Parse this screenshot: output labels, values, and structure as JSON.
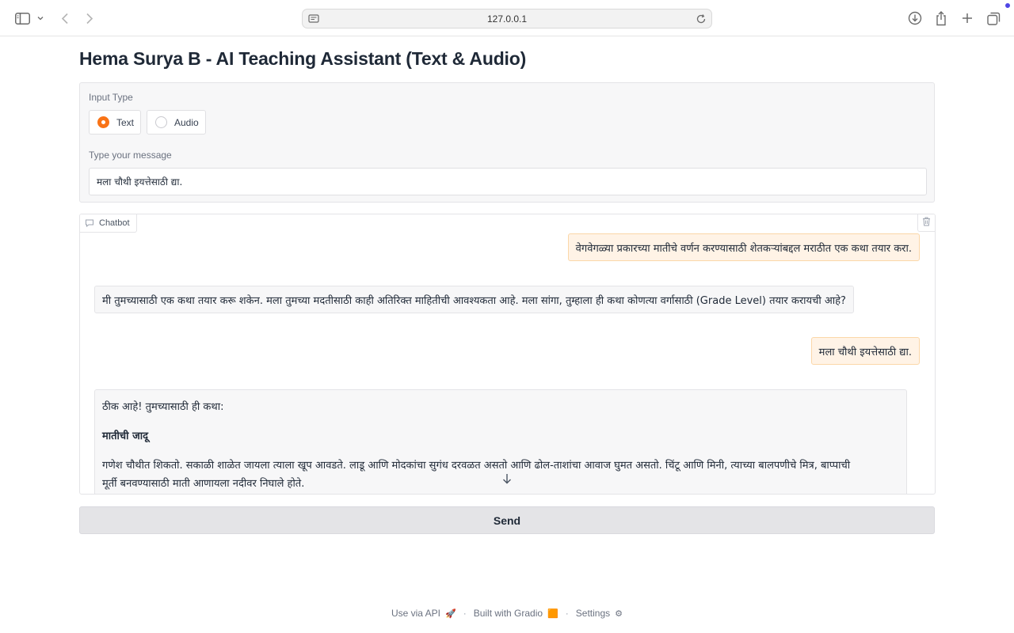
{
  "browser": {
    "url": "127.0.0.1",
    "icons": [
      "sidebar-icon",
      "chevron-down-icon",
      "back-arrow-icon",
      "forward-arrow-icon",
      "site-settings-icon",
      "reload-icon",
      "download-icon",
      "share-icon",
      "new-tab-plus-icon",
      "tabs-overview-icon"
    ],
    "accent": "#4f46e5"
  },
  "app": {
    "title": "Hema Surya B - AI Teaching Assistant (Text & Audio)",
    "accent": "#f97316"
  },
  "input_panel": {
    "input_type_label": "Input Type",
    "options": [
      {
        "label": "Text",
        "selected": true
      },
      {
        "label": "Audio",
        "selected": false
      }
    ],
    "message_label": "Type your message",
    "message_value": "मला चौथी इयत्तेसाठी द्या."
  },
  "chatbot": {
    "label": "Chatbot",
    "messages": [
      {
        "role": "user",
        "text": "वेगवेगळ्या प्रकारच्या मातीचे वर्णन करण्यासाठी शेतकऱ्यांबद्दल मराठीत एक कथा तयार करा."
      },
      {
        "role": "assistant",
        "text": "मी तुमच्यासाठी एक कथा तयार करू शकेन. मला तुमच्या मदतीसाठी काही अतिरिक्त माहितीची आवश्यकता आहे. मला सांगा, तुम्हाला ही कथा कोणत्या वर्गासाठी (Grade Level) तयार करायची आहे?"
      },
      {
        "role": "user",
        "text": "मला चौथी इयत्तेसाठी द्या."
      },
      {
        "role": "assistant",
        "intro": "ठीक आहे! तुमच्यासाठी ही कथा:",
        "story_title": "मातीची जादू",
        "paragraph_line1": "गणेश चौथीत शिकतो. सकाळी शाळेत जायला त्याला खूप आवडते. लाडू आणि मोदकांचा सुगंध दरवळत असतो आणि ढोल-ताशांचा आवाज घुमत असतो. चिंटू आणि मिनी, त्याच्या बालपणीचे मित्र, बाप्पाची",
        "paragraph_line2": "मूर्ती बनवण्यासाठी माती आणायला नदीवर निघाले होते."
      }
    ]
  },
  "send_button": "Send",
  "footer": {
    "api": "Use via API",
    "api_icon": "🚀",
    "built": "Built with Gradio",
    "built_icon": "🟧",
    "settings": "Settings",
    "settings_icon": "⚙",
    "separator": "·"
  }
}
